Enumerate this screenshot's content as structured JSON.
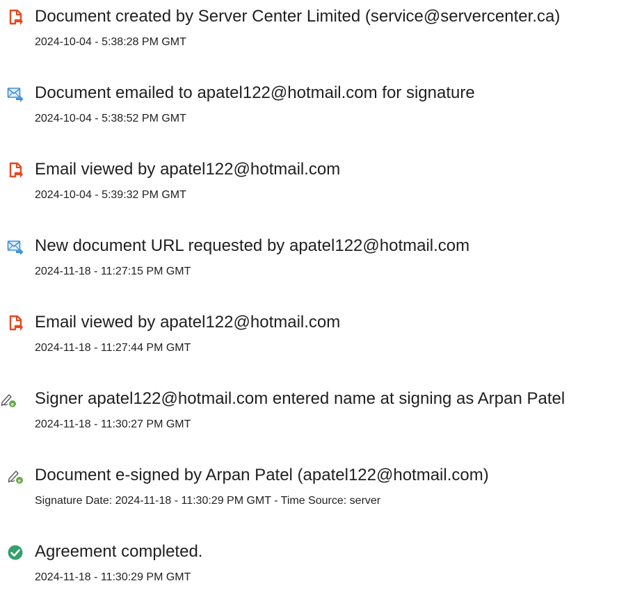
{
  "events": [
    {
      "icon": "document-created-icon",
      "title": "Document created by Server Center Limited (service@servercenter.ca)",
      "timestamp": "2024-10-04 - 5:38:28 PM GMT"
    },
    {
      "icon": "email-sent-icon",
      "title": "Document emailed to apatel122@hotmail.com for signature",
      "timestamp": "2024-10-04 - 5:38:52 PM GMT"
    },
    {
      "icon": "email-viewed-icon",
      "title": "Email viewed by apatel122@hotmail.com",
      "timestamp": "2024-10-04 - 5:39:32 PM GMT"
    },
    {
      "icon": "email-sent-icon",
      "title": "New document URL requested by apatel122@hotmail.com",
      "timestamp": "2024-11-18 - 11:27:15 PM GMT"
    },
    {
      "icon": "email-viewed-icon",
      "title": "Email viewed by apatel122@hotmail.com",
      "timestamp": "2024-11-18 - 11:27:44 PM GMT"
    },
    {
      "icon": "signature-pen-icon",
      "title": "Signer apatel122@hotmail.com entered name at signing as Arpan Patel",
      "timestamp": "2024-11-18 - 11:30:27 PM GMT"
    },
    {
      "icon": "signature-pen-icon",
      "title": "Document e-signed by Arpan Patel (apatel122@hotmail.com)",
      "timestamp": "Signature Date: 2024-11-18 - 11:30:29 PM GMT - Time Source: server"
    },
    {
      "icon": "check-circle-icon",
      "title": "Agreement completed.",
      "timestamp": "2024-11-18 - 11:30:29 PM GMT"
    }
  ],
  "colors": {
    "document_icon": "#e8471f",
    "email_icon": "#3e8fd6",
    "pen_icon": "#6aa84f",
    "check_icon": "#34a06b",
    "text": "#1f1f1f"
  }
}
